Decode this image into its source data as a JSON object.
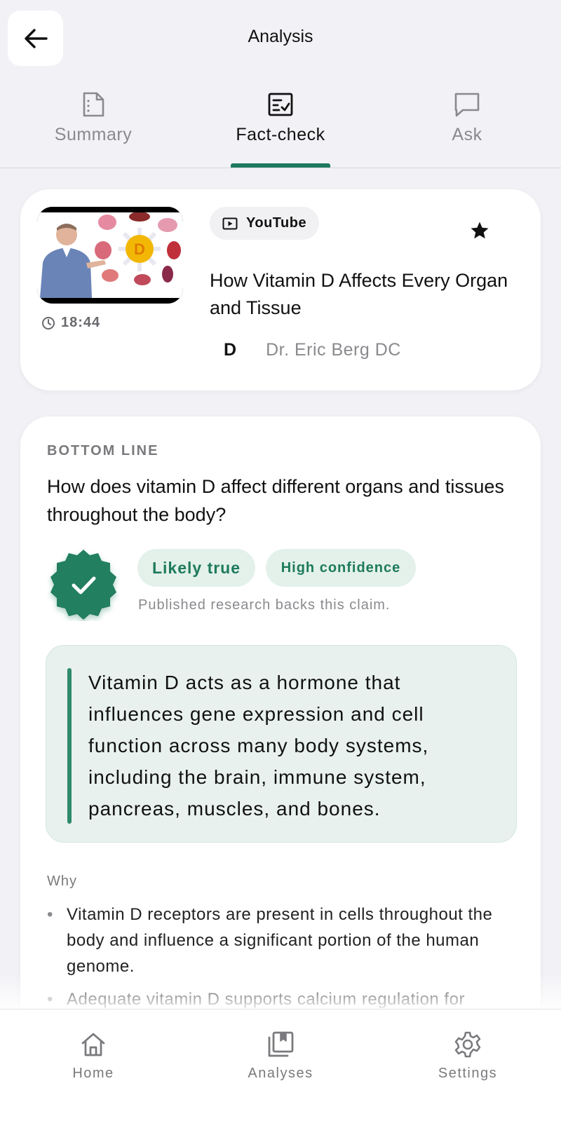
{
  "header": {
    "title": "Analysis"
  },
  "tabs": [
    {
      "label": "Summary",
      "icon": "document-icon",
      "active": false
    },
    {
      "label": "Fact-check",
      "icon": "checklist-icon",
      "active": true
    },
    {
      "label": "Ask",
      "icon": "chat-bubble-icon",
      "active": false
    }
  ],
  "video": {
    "platform": "YouTube",
    "title": "How Vitamin D Affects Every Organ and Tissue",
    "duration": "18:44",
    "channel_initial": "D",
    "channel_name": "Dr. Eric Berg DC",
    "thumbnail_text": "D",
    "starred": true
  },
  "fact_check": {
    "section_label": "BOTTOM LINE",
    "question": "How does vitamin D affect different organs and tissues throughout the body?",
    "verdict": "Likely true",
    "confidence": "High confidence",
    "verdict_note": "Published research backs this claim.",
    "summary_quote": "Vitamin D acts as a hormone that influences gene expression and cell function across many body systems, including the brain, immune system, pancreas, muscles, and bones.",
    "why_label": "Why",
    "why_points": [
      "Vitamin D receptors are present in cells throughout the body and influence a significant portion of the human genome.",
      "Adequate vitamin D supports calcium regulation for"
    ]
  },
  "nav": [
    {
      "label": "Home",
      "icon": "home-icon"
    },
    {
      "label": "Analyses",
      "icon": "bookmark-stack-icon"
    },
    {
      "label": "Settings",
      "icon": "gear-icon"
    }
  ],
  "colors": {
    "accent": "#1e7a5d",
    "chip_bg": "#e3f1ea",
    "quote_bg": "#e8f1ee"
  }
}
